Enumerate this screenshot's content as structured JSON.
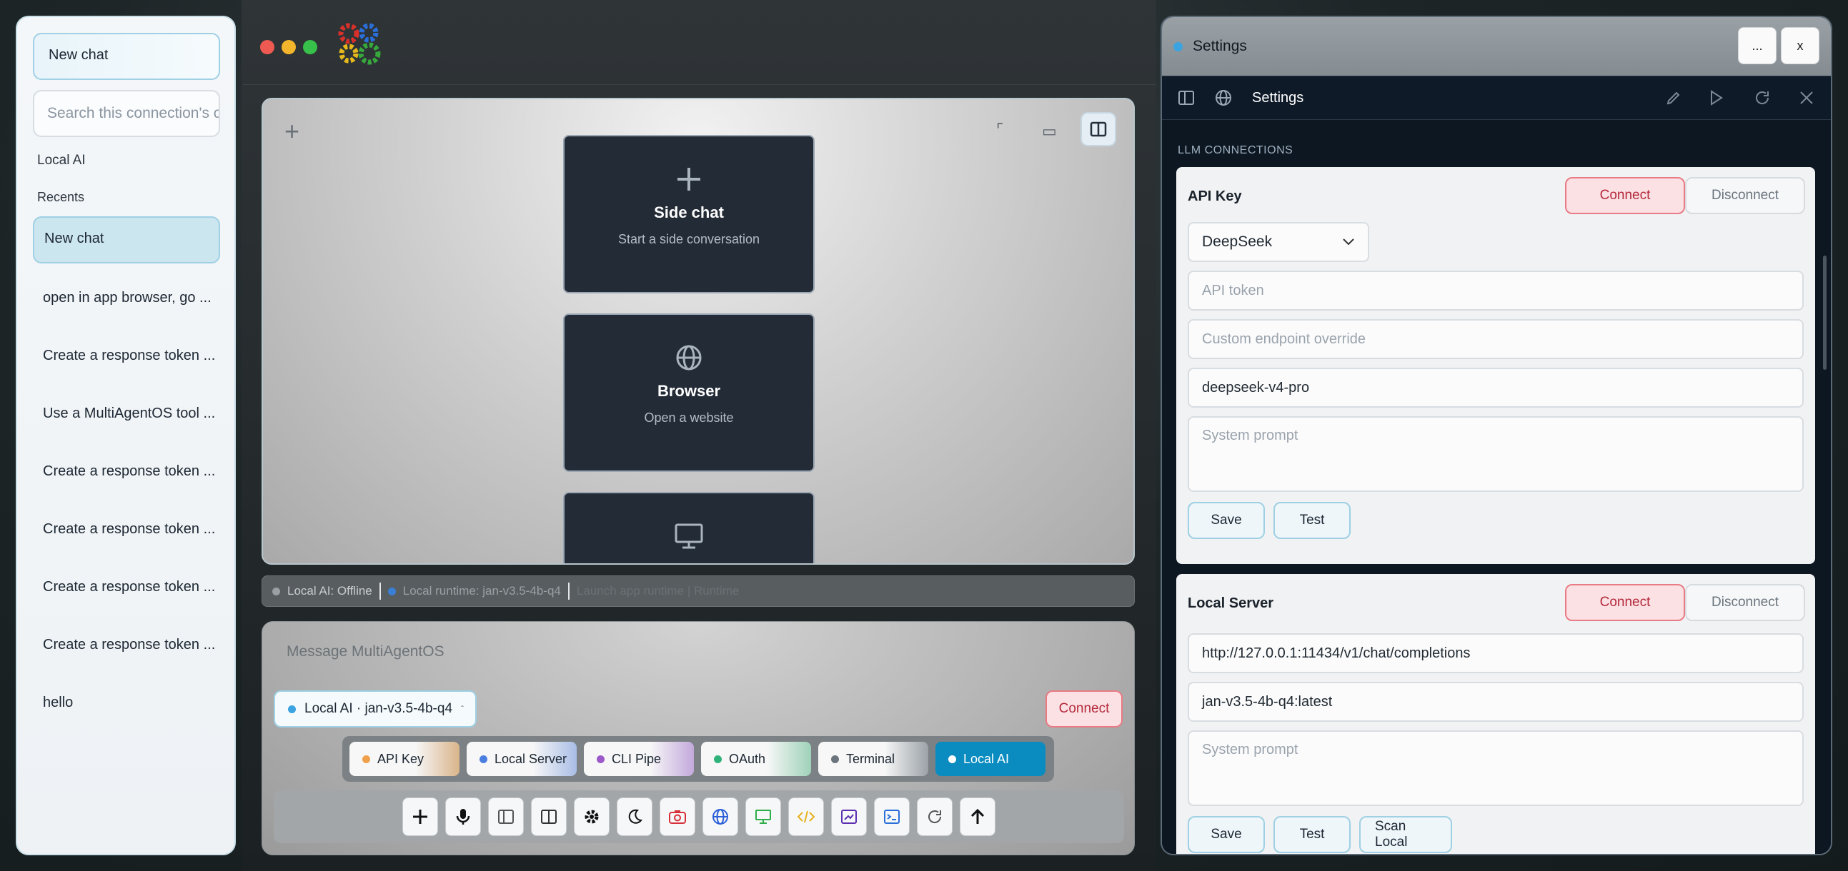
{
  "sidebar": {
    "new_chat_label": "New chat",
    "search_placeholder": "Search this connection's chats",
    "connection_label": "Local AI",
    "recents_label": "Recents",
    "active_item": "New chat",
    "recents": [
      "open in app browser, go ...",
      "Create a response token ...",
      "Use a MultiAgentOS tool ...",
      "Create a response token ...",
      "Create a response token ...",
      "Create a response token ...",
      "Create a response token ...",
      "hello"
    ]
  },
  "canvas": {
    "cards": [
      {
        "icon": "plus-icon",
        "title": "Side chat",
        "subtitle": "Start a side conversation"
      },
      {
        "icon": "globe-icon",
        "title": "Browser",
        "subtitle": "Open a website"
      },
      {
        "icon": "monitor-icon",
        "title": "",
        "subtitle": ""
      }
    ]
  },
  "status": {
    "local_ai": "Local AI: Offline",
    "runtime": "Local runtime: jan-v3.5-4b-q4",
    "faded": "Launch app runtime | Runtime"
  },
  "composer": {
    "placeholder": "Message MultiAgentOS",
    "model": "Local AI · jan-v3.5-4b-q4",
    "connect_label": "Connect",
    "tabs": [
      {
        "label": "API Key",
        "color": "#f0a04b"
      },
      {
        "label": "Local Server",
        "color": "#4a7fe0"
      },
      {
        "label": "CLI Pipe",
        "color": "#9b59c9"
      },
      {
        "label": "OAuth",
        "color": "#2fb37a"
      },
      {
        "label": "Terminal",
        "color": "#6b747c"
      },
      {
        "label": "Local AI",
        "color": "#ffffff"
      }
    ],
    "active_tab": "Local AI"
  },
  "settings": {
    "window_title": "Settings",
    "more_label": "...",
    "close_label": "x",
    "header_title": "Settings",
    "section_label": "LLM CONNECTIONS",
    "api_key": {
      "title": "API Key",
      "connect_label": "Connect",
      "disconnect_label": "Disconnect",
      "provider": "DeepSeek",
      "token_placeholder": "API token",
      "endpoint_placeholder": "Custom endpoint override",
      "model": "deepseek-v4-pro",
      "prompt_placeholder": "System prompt",
      "save_label": "Save",
      "test_label": "Test"
    },
    "local_server": {
      "title": "Local Server",
      "connect_label": "Connect",
      "disconnect_label": "Disconnect",
      "url": "http://127.0.0.1:11434/v1/chat/completions",
      "model": "jan-v3.5-4b-q4:latest",
      "prompt_placeholder": "System prompt",
      "save_label": "Save",
      "test_label": "Test",
      "scan_label": "Scan Local"
    }
  },
  "colors": {
    "accent": "#0a8cc0",
    "danger": "#ea7b84",
    "status_online": "#3aa3e0"
  }
}
